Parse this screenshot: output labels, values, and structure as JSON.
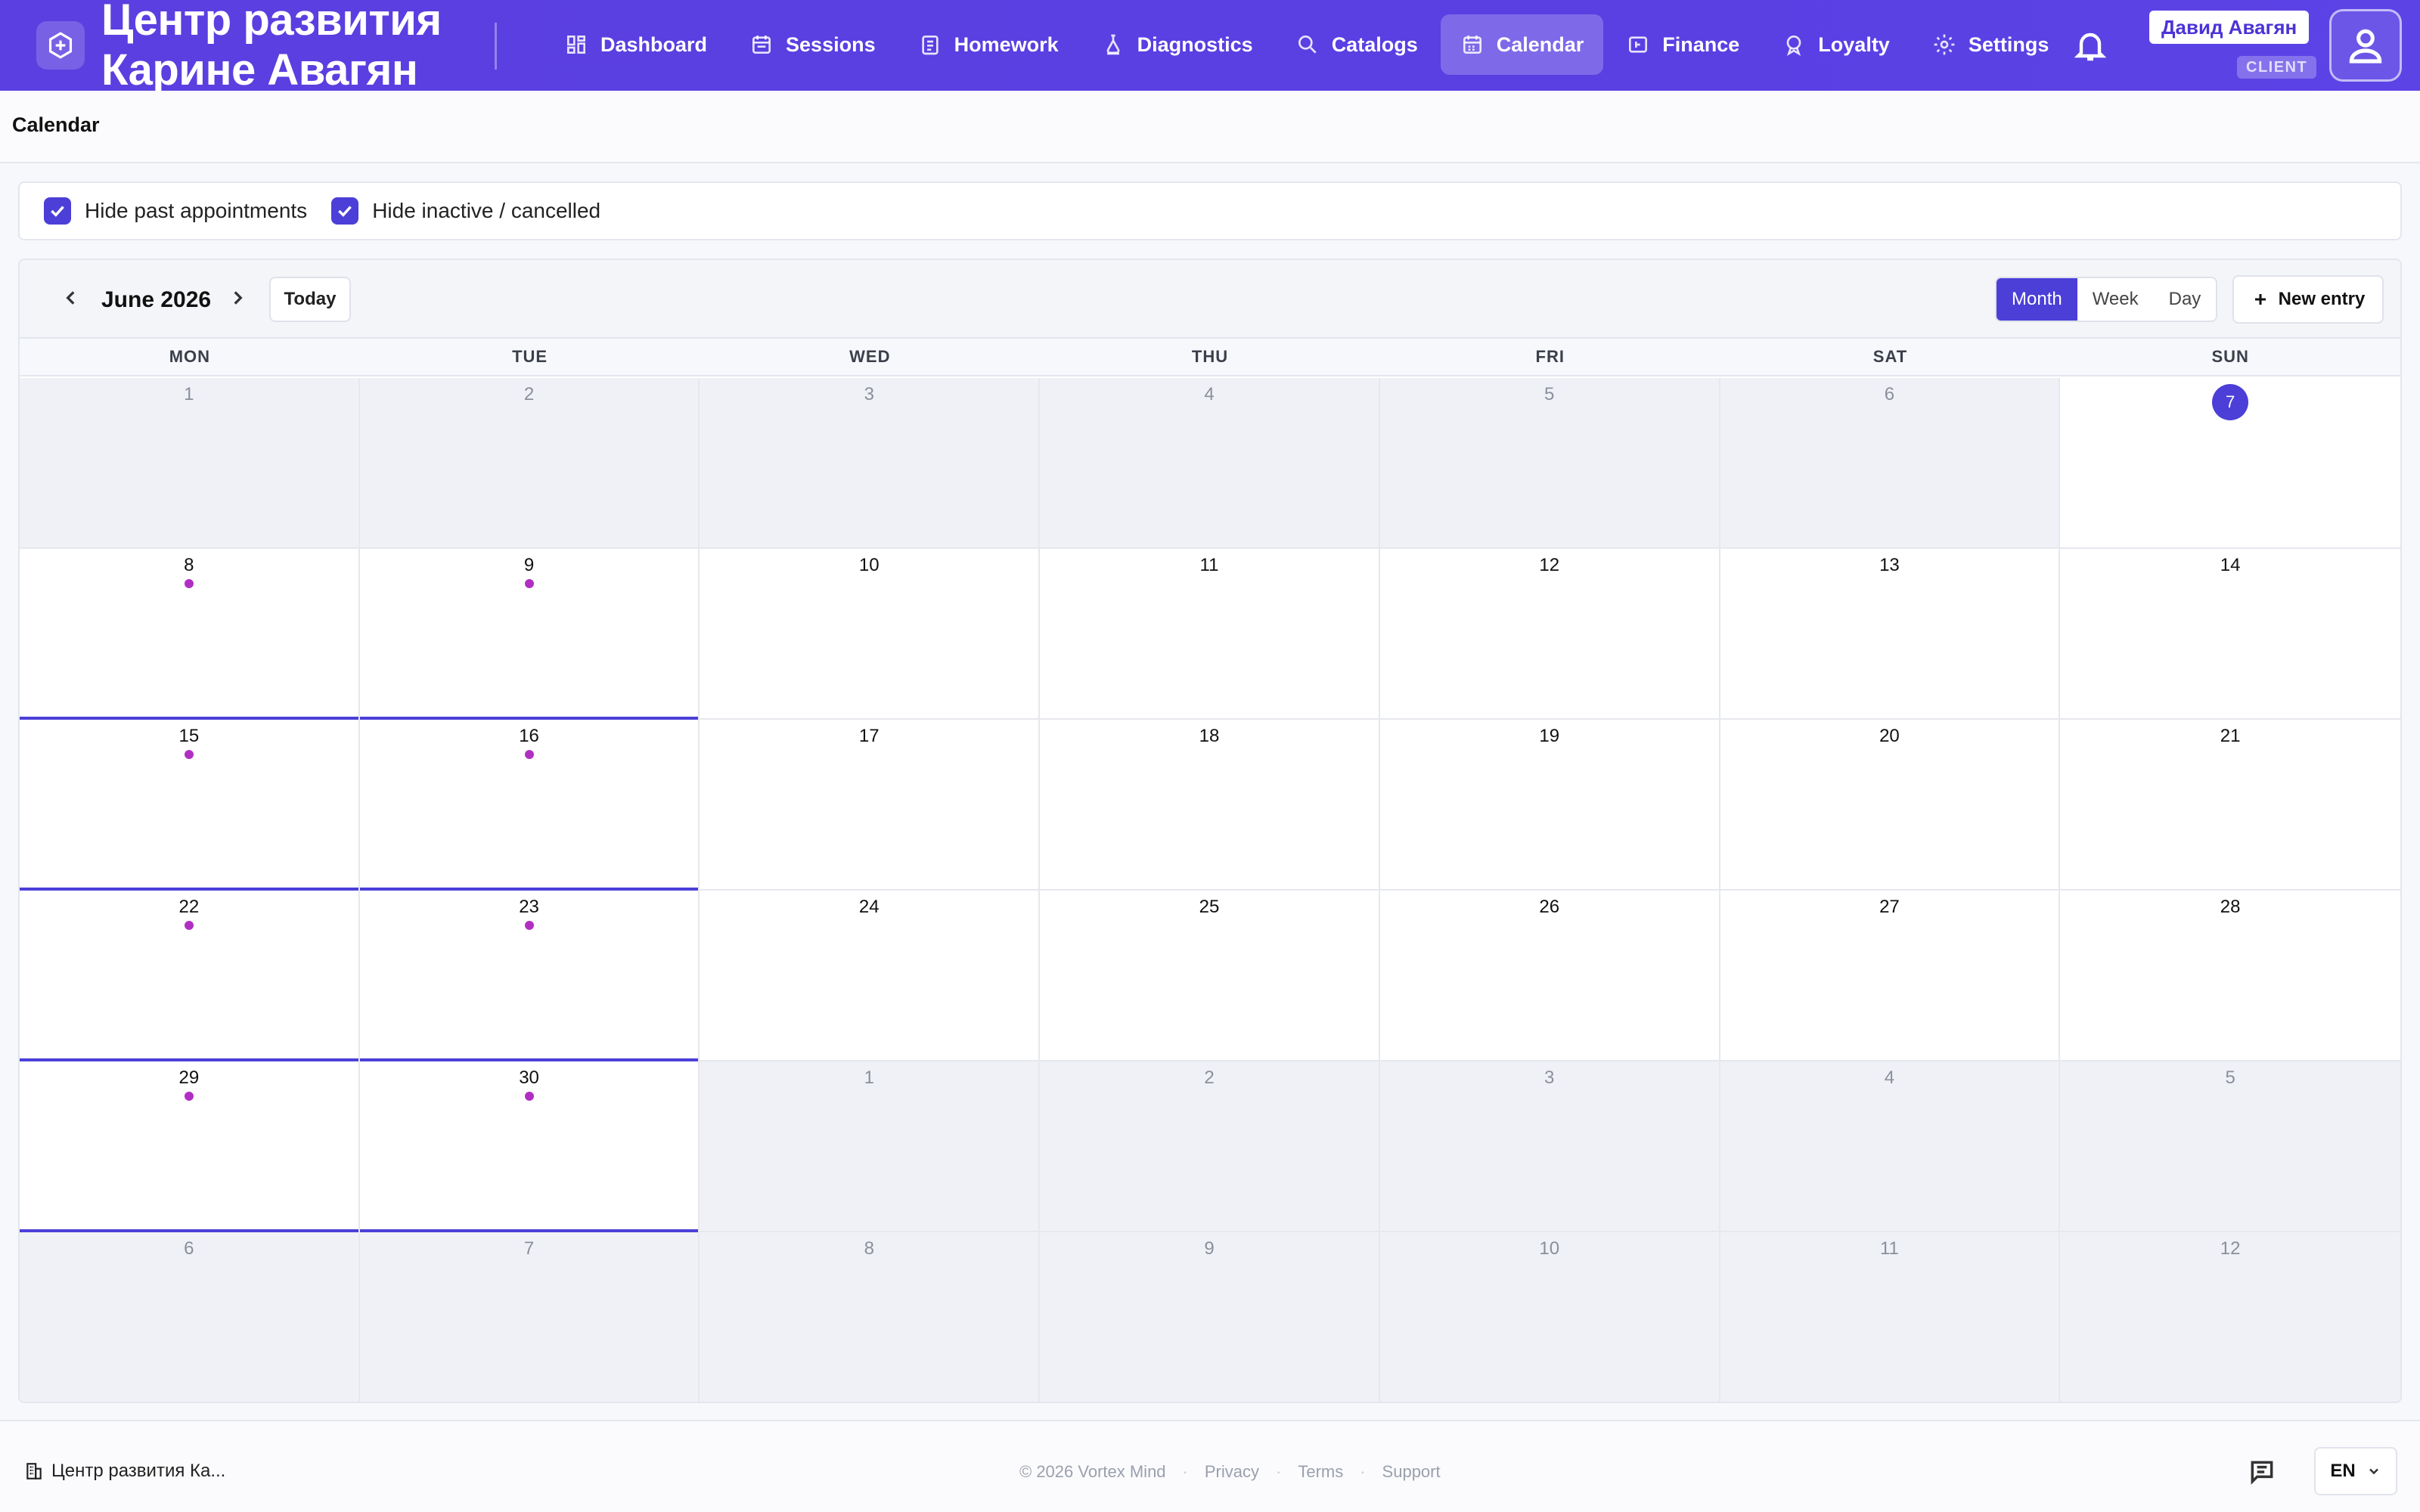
{
  "app": {
    "brand_title_line1": "Центр развития",
    "brand_title_line2": "Карине Авагян",
    "accent_color": "#4b3fd8"
  },
  "nav": {
    "items": [
      {
        "label": "Dashboard",
        "icon": "dashboard-icon",
        "active": false
      },
      {
        "label": "Sessions",
        "icon": "sessions-icon",
        "active": false
      },
      {
        "label": "Homework",
        "icon": "homework-icon",
        "active": false
      },
      {
        "label": "Diagnostics",
        "icon": "diagnostics-icon",
        "active": false
      },
      {
        "label": "Catalogs",
        "icon": "search-icon",
        "active": false
      },
      {
        "label": "Calendar",
        "icon": "calendar-icon",
        "active": true
      },
      {
        "label": "Finance",
        "icon": "wallet-icon",
        "active": false
      },
      {
        "label": "Loyalty",
        "icon": "award-icon",
        "active": false
      },
      {
        "label": "Settings",
        "icon": "gear-icon",
        "active": false
      }
    ]
  },
  "user": {
    "name": "Давид Авагян",
    "role": "CLIENT"
  },
  "page": {
    "title": "Calendar"
  },
  "filters": {
    "hide_past": {
      "label": "Hide past appointments",
      "checked": true
    },
    "hide_inactive": {
      "label": "Hide inactive / cancelled",
      "checked": true
    }
  },
  "calendar": {
    "month_label": "June 2026",
    "today_label": "Today",
    "views": [
      "Month",
      "Week",
      "Day"
    ],
    "active_view": "Month",
    "new_entry_label": "New entry",
    "weekdays": [
      "MON",
      "TUE",
      "WED",
      "THU",
      "FRI",
      "SAT",
      "SUN"
    ],
    "days": [
      {
        "n": "1",
        "dim": true
      },
      {
        "n": "2",
        "dim": true
      },
      {
        "n": "3",
        "dim": true
      },
      {
        "n": "4",
        "dim": true
      },
      {
        "n": "5",
        "dim": true
      },
      {
        "n": "6",
        "dim": true
      },
      {
        "n": "7",
        "today": true
      },
      {
        "n": "8",
        "event": true
      },
      {
        "n": "9",
        "event": true
      },
      {
        "n": "10"
      },
      {
        "n": "11"
      },
      {
        "n": "12"
      },
      {
        "n": "13"
      },
      {
        "n": "14"
      },
      {
        "n": "15",
        "event": true
      },
      {
        "n": "16",
        "event": true
      },
      {
        "n": "17"
      },
      {
        "n": "18"
      },
      {
        "n": "19"
      },
      {
        "n": "20"
      },
      {
        "n": "21"
      },
      {
        "n": "22",
        "event": true
      },
      {
        "n": "23",
        "event": true
      },
      {
        "n": "24"
      },
      {
        "n": "25"
      },
      {
        "n": "26"
      },
      {
        "n": "27"
      },
      {
        "n": "28"
      },
      {
        "n": "29",
        "event": true
      },
      {
        "n": "30",
        "event": true
      },
      {
        "n": "1",
        "dim": true
      },
      {
        "n": "2",
        "dim": true
      },
      {
        "n": "3",
        "dim": true
      },
      {
        "n": "4",
        "dim": true
      },
      {
        "n": "5",
        "dim": true
      },
      {
        "n": "6",
        "dim": true
      },
      {
        "n": "7",
        "dim": true
      },
      {
        "n": "8",
        "dim": true
      },
      {
        "n": "9",
        "dim": true
      },
      {
        "n": "10",
        "dim": true
      },
      {
        "n": "11",
        "dim": true
      },
      {
        "n": "12",
        "dim": true
      }
    ],
    "event_dot_color": "#b02fc2"
  },
  "footer": {
    "org": "Центр развития Ка...",
    "copyright": "© 2026 Vortex Mind",
    "links": [
      "Privacy",
      "Terms",
      "Support"
    ],
    "lang": "EN"
  }
}
